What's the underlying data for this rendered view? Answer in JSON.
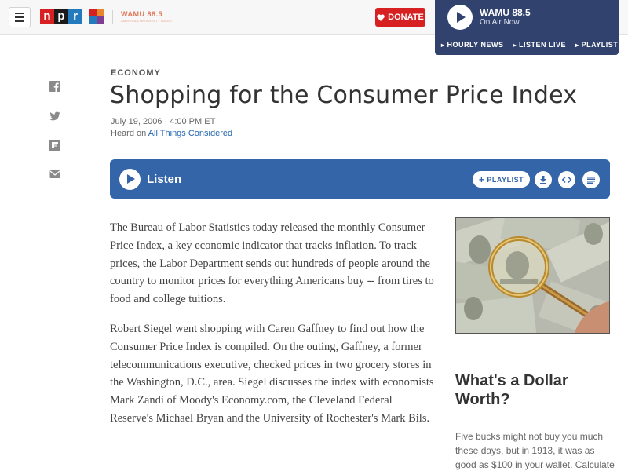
{
  "header": {
    "menu_icon": "hamburger-icon",
    "logo_letters": [
      "n",
      "p",
      "r"
    ],
    "station_logo": "WAMU 88.5",
    "station_logo_sub": "AMERICAN UNIVERSITY RADIO",
    "donate_label": "DONATE",
    "donate_icon": "heart-icon"
  },
  "player": {
    "station": "WAMU 88.5",
    "status": "On Air Now",
    "links": [
      "HOURLY NEWS",
      "LISTEN LIVE",
      "PLAYLIST"
    ]
  },
  "share": {
    "icons": [
      "facebook-icon",
      "twitter-icon",
      "flipboard-icon",
      "email-icon"
    ]
  },
  "article": {
    "kicker": "ECONOMY",
    "title": "Shopping for the Consumer Price Index",
    "dateline": "July 19, 2006 · 4:00 PM ET",
    "heard_prefix": "Heard on ",
    "heard_show": "All Things Considered",
    "paragraphs": [
      "The Bureau of Labor Statistics today released the monthly Consumer Price Index, a key economic indicator that tracks inflation. To track prices, the Labor Department sends out hundreds of people around the country to monitor prices for everything Americans buy -- from tires to food and college tuitions.",
      "Robert Siegel went shopping with Caren Gaffney to find out how the Consumer Price Index is compiled. On the outing, Gaffney, a former telecommunications executive, checked prices in two grocery stores in the Washington, D.C., area. Siegel discusses the index with economists Mark Zandi of Moody's Economy.com, the Cleveland Federal Reserve's Michael Bryan and the University of Rochester's Mark Bils."
    ]
  },
  "listen": {
    "label": "Listen",
    "playlist_label": "PLAYLIST",
    "icons": [
      "download-icon",
      "embed-icon",
      "transcript-icon"
    ]
  },
  "sidebar": {
    "title": "What's a Dollar Worth?",
    "text": "Five bucks might not buy you much these days, but in 1913, it was as good as $100 in your wallet. Calculate the"
  },
  "colors": {
    "npr_red": "#d62021",
    "npr_black": "#1a1a1a",
    "npr_blue": "#237bbd",
    "player_bg": "#31426e",
    "listen_bg": "#3565a9",
    "link": "#2466b0"
  }
}
